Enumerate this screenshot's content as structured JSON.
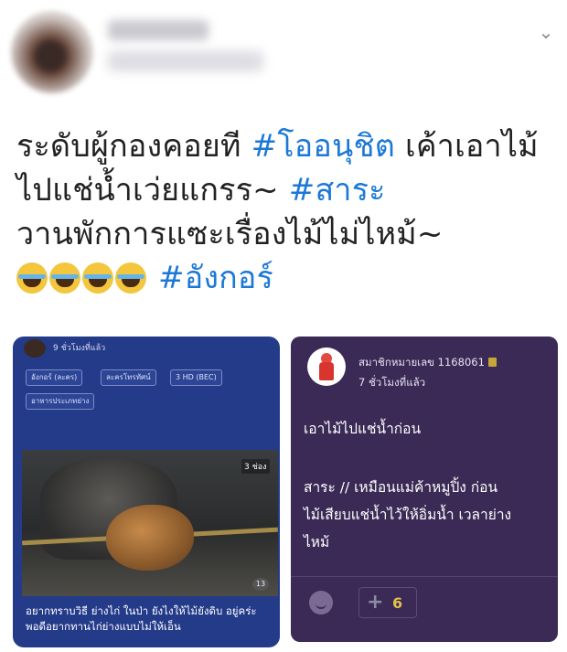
{
  "tweet": {
    "lines": [
      {
        "text": "ระดับผู้กองคอยที ",
        "tag": "#โออนุชิต",
        "rest": " เค้าเอาไม้"
      },
      {
        "text": "ไปแช่น้ำเว่ยแกรร~ ",
        "tag": "#สาระ"
      },
      {
        "text": "วานพักการแซะเรื่องไม้ไม่ไหม้~"
      }
    ],
    "emoji_tag": "#อังกอร์"
  },
  "left_card": {
    "time": "9 ชั่วโมงที่แล้ว",
    "chips": [
      "อังกอร์ (ละคร)",
      "ละครโทรทัศน์",
      "3 HD (BEC)",
      "อาหารประเภทย่าง"
    ],
    "photo_logo": "3 ช่อง",
    "photo_logo2": "13",
    "caption": "อยากทราบวิธี ย่างไก่ ในป่า ยังไงให้ไม้ยังดิบ อยู่คร่ะ พอดีอยากทานไก่ย่างแบบไม่ให้เอ็น"
  },
  "right_card": {
    "member": "สมาชิกหมายเลข 1168061",
    "time": "7 ชั่วโมงที่แล้ว",
    "text1": "เอาไม้ไปแช่น้ำก่อน",
    "text2_lines": [
      "สาระ // เหมือนแม่ค้าหมูปิ้ง ก่อน",
      "ไม้เสียบแช่น้ำไว้ให้อิ่มน้ำ เวลาย่าง",
      "ไหม้"
    ],
    "plus_count": "6"
  }
}
